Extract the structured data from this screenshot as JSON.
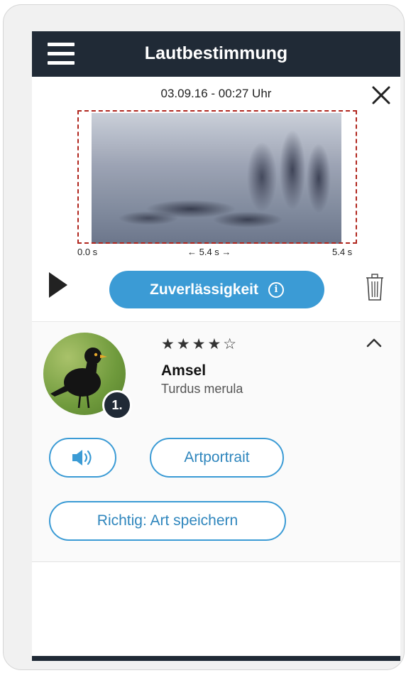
{
  "header": {
    "title": "Lautbestimmung"
  },
  "recording": {
    "datetime": "03.09.16 - 00:27 Uhr",
    "axis": {
      "start": "0.0 s",
      "duration": "← 5.4 s →",
      "end": "5.4 s"
    },
    "reliability_label": "Zuverlässigkeit",
    "info_glyph": "i"
  },
  "result": {
    "rank": "1.",
    "stars": "★★★★☆",
    "rating": 4,
    "rating_max": 5,
    "common_name": "Amsel",
    "latin_name": "Turdus merula",
    "portrait_label": "Artportrait",
    "save_label": "Richtig: Art speichern"
  },
  "icons": {
    "menu": "hamburger-menu-icon",
    "close": "close-icon",
    "play": "play-icon",
    "info": "info-icon",
    "trash": "trash-icon",
    "collapse": "chevron-up-icon",
    "sound": "speaker-icon"
  },
  "colors": {
    "header_bg": "#202a36",
    "accent": "#3b9bd5",
    "selection_border": "#b0261e"
  }
}
